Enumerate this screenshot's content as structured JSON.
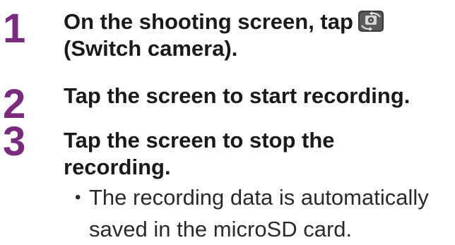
{
  "steps": [
    {
      "number": "1",
      "lines": [
        "On the shooting screen, tap",
        "(Switch camera)."
      ],
      "icon": "switch-camera-icon"
    },
    {
      "number": "2",
      "lines": [
        "Tap the screen to start recording."
      ]
    },
    {
      "number": "3",
      "lines": [
        "Tap the screen to stop the",
        "recording."
      ]
    }
  ],
  "note": {
    "bullet": "•",
    "lines": [
      "The recording data is automatically",
      "saved in the microSD card."
    ]
  },
  "colors": {
    "step_number": "#7a2a7f",
    "text": "#1a1a1a"
  }
}
